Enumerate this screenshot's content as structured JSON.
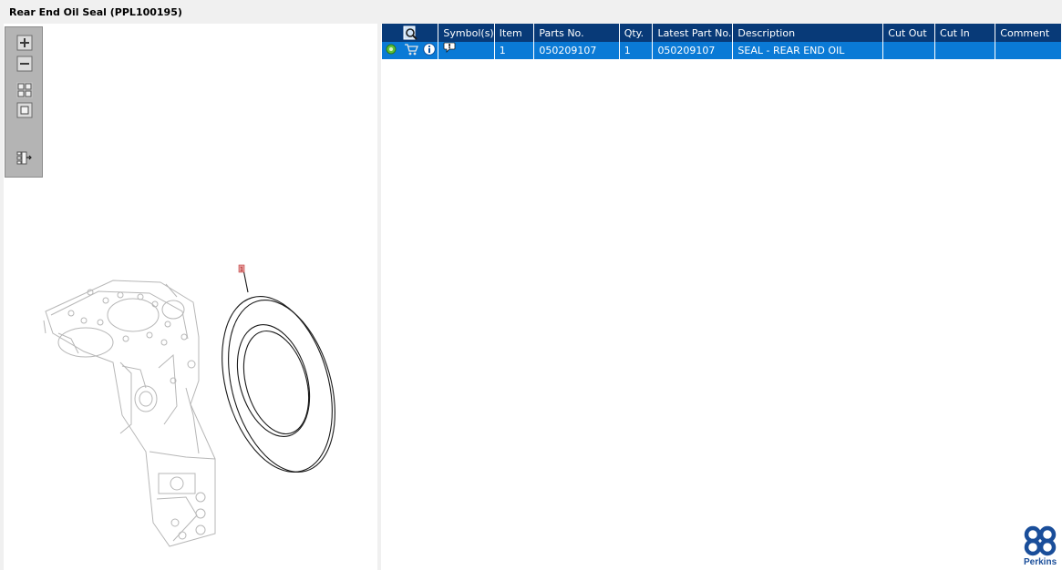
{
  "window": {
    "title": "Rear End Oil Seal (PPL100195)"
  },
  "toolbar": {
    "buttons": [
      "zoom-in-icon",
      "zoom-out-icon",
      "fit-all-icon",
      "fit-window-icon",
      "export-list-icon"
    ]
  },
  "drawing": {
    "callout_label": "1"
  },
  "table": {
    "headers": [
      "",
      "Symbol(s)",
      "Item",
      "Parts No.",
      "Qty.",
      "Latest Part No.",
      "Description",
      "Cut Out",
      "Cut In",
      "Comment"
    ],
    "rows": [
      {
        "item": "1",
        "parts_no": "050209107",
        "qty": "1",
        "latest_part_no": "050209107",
        "description": "SEAL - REAR END OIL",
        "cut_out": "",
        "cut_in": "",
        "comment": ""
      }
    ]
  },
  "logo": {
    "text": "Perkins"
  },
  "colors": {
    "header_bg": "#083a78",
    "selected_row_bg": "#0a7ad6",
    "logo_blue": "#1a4e9a"
  }
}
